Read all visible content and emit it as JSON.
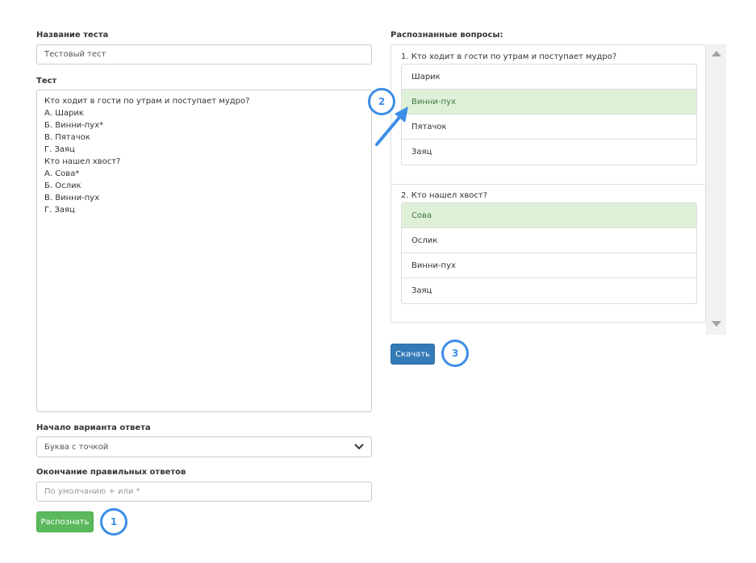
{
  "form": {
    "name_label": "Название теста",
    "name_value": "Тестовый тест",
    "test_label": "Тест",
    "test_lines": [
      "Кто ходит в гости по утрам и поступает мудро?",
      "А. Шарик",
      "Б. Винни-пух*",
      "В. Пятачок",
      "Г. Заяц",
      "Кто нашел хвост?",
      "А. Сова*",
      "Б. Ослик",
      "В. Винни-пух",
      "Г. Заяц"
    ],
    "answer_start_label": "Начало варианта ответа",
    "answer_start_value": "Буква с точкой",
    "correct_end_label": "Окончание правильных ответов",
    "correct_end_placeholder": "По умолчанию + или *",
    "recognize_button": "Распознать"
  },
  "results": {
    "label": "Распознанные вопросы:",
    "questions": [
      {
        "title": "1. Кто ходит в гости по утрам и поступает мудро?",
        "answers": [
          {
            "text": "Шарик",
            "correct": false
          },
          {
            "text": "Винни-пух",
            "correct": true
          },
          {
            "text": "Пятачок",
            "correct": false
          },
          {
            "text": "Заяц",
            "correct": false
          }
        ]
      },
      {
        "title": "2. Кто нашел хвост?",
        "answers": [
          {
            "text": "Сова",
            "correct": true
          },
          {
            "text": "Ослик",
            "correct": false
          },
          {
            "text": "Винни-пух",
            "correct": false
          },
          {
            "text": "Заяц",
            "correct": false
          }
        ]
      }
    ],
    "download_button": "Скачать"
  },
  "callouts": {
    "one": "1",
    "two": "2",
    "three": "3"
  },
  "colors": {
    "correct_bg": "#dff0d8",
    "correct_text": "#3c763d",
    "callout": "#3d8ee8",
    "green_button": "#5cb85c",
    "blue_button": "#337ab7"
  }
}
